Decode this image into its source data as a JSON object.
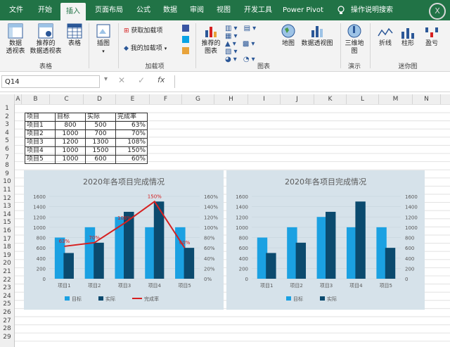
{
  "tabs": [
    "文件",
    "开始",
    "插入",
    "页面布局",
    "公式",
    "数据",
    "审阅",
    "视图",
    "开发工具",
    "Power Pivot",
    "操作说明搜索"
  ],
  "ribbon": {
    "pivot": "数据\n透视表",
    "rec_pivot": "推荐的\n数据透视表",
    "table": "表格",
    "illus": "插图",
    "get_addins": "获取加载项",
    "my_addins": "我的加载项",
    "rec_charts": "推荐的\n图表",
    "map": "地图",
    "pivot_chart": "数据透视图",
    "map3d": "三维地\n图",
    "line": "折线",
    "column": "柱形",
    "winloss": "盈亏",
    "g_tables": "表格",
    "g_addins": "加载项",
    "g_charts": "图表",
    "g_tours": "演示",
    "g_spark": "迷你图"
  },
  "formula": {
    "namebox": "Q14",
    "fx": "fx"
  },
  "columns": [
    "A",
    "B",
    "C",
    "D",
    "E",
    "F",
    "G",
    "H",
    "I",
    "J",
    "K",
    "L",
    "M",
    "N"
  ],
  "rows": [
    "1",
    "2",
    "3",
    "4",
    "5",
    "6",
    "7",
    "8",
    "9",
    "10",
    "11",
    "12",
    "13",
    "14",
    "15",
    "16",
    "17",
    "18",
    "19",
    "20",
    "21",
    "22",
    "23",
    "24",
    "25",
    "26",
    "27",
    "28",
    "29"
  ],
  "table": {
    "headers": [
      "项目",
      "目标",
      "实际",
      "完成率"
    ],
    "rows": [
      [
        "项目1",
        "800",
        "500",
        "63%"
      ],
      [
        "项目2",
        "1000",
        "700",
        "70%"
      ],
      [
        "项目3",
        "1200",
        "1300",
        "108%"
      ],
      [
        "项目4",
        "1000",
        "1500",
        "150%"
      ],
      [
        "项目5",
        "1000",
        "600",
        "60%"
      ]
    ]
  },
  "chart_data": [
    {
      "type": "bar",
      "title": "2020年各项目完成情况",
      "categories": [
        "项目1",
        "项目2",
        "项目3",
        "项目4",
        "项目5"
      ],
      "series": [
        {
          "name": "目标",
          "values": [
            800,
            1000,
            1200,
            1000,
            1000
          ],
          "color": "#1ba1e2"
        },
        {
          "name": "实际",
          "values": [
            500,
            700,
            1300,
            1500,
            600
          ],
          "color": "#0b4a6e"
        },
        {
          "name": "完成率",
          "values": [
            0.63,
            0.7,
            1.08,
            1.5,
            0.6
          ],
          "color": "#d62020",
          "type": "line",
          "axis": "secondary",
          "labels": [
            "63%",
            "70%",
            "108%",
            "150%",
            "60%"
          ]
        }
      ],
      "ylim": [
        0,
        1600
      ],
      "y_ticks": [
        "0",
        "200",
        "400",
        "600",
        "800",
        "1000",
        "1200",
        "1400",
        "1600"
      ],
      "y2lim": [
        0,
        1.6
      ],
      "y2_ticks": [
        "0%",
        "20%",
        "40%",
        "60%",
        "80%",
        "100%",
        "120%",
        "140%",
        "160%"
      ],
      "legend": "bottom",
      "grid": true
    },
    {
      "type": "bar",
      "title": "2020年各项目完成情况",
      "categories": [
        "项目1",
        "项目2",
        "项目3",
        "项目4",
        "项目5"
      ],
      "series": [
        {
          "name": "目标",
          "values": [
            800,
            1000,
            1200,
            1000,
            1000
          ],
          "color": "#1ba1e2"
        },
        {
          "name": "实际",
          "values": [
            500,
            700,
            1300,
            1500,
            600
          ],
          "color": "#0b4a6e"
        }
      ],
      "ylim": [
        0,
        1600
      ],
      "y_ticks": [
        "0",
        "200",
        "400",
        "600",
        "800",
        "1000",
        "1200",
        "1400",
        "1600"
      ],
      "y2_ticks": [
        "0",
        "200",
        "400",
        "600",
        "800",
        "1000",
        "1200",
        "1400",
        "1600"
      ],
      "legend": "bottom",
      "grid": true
    }
  ]
}
